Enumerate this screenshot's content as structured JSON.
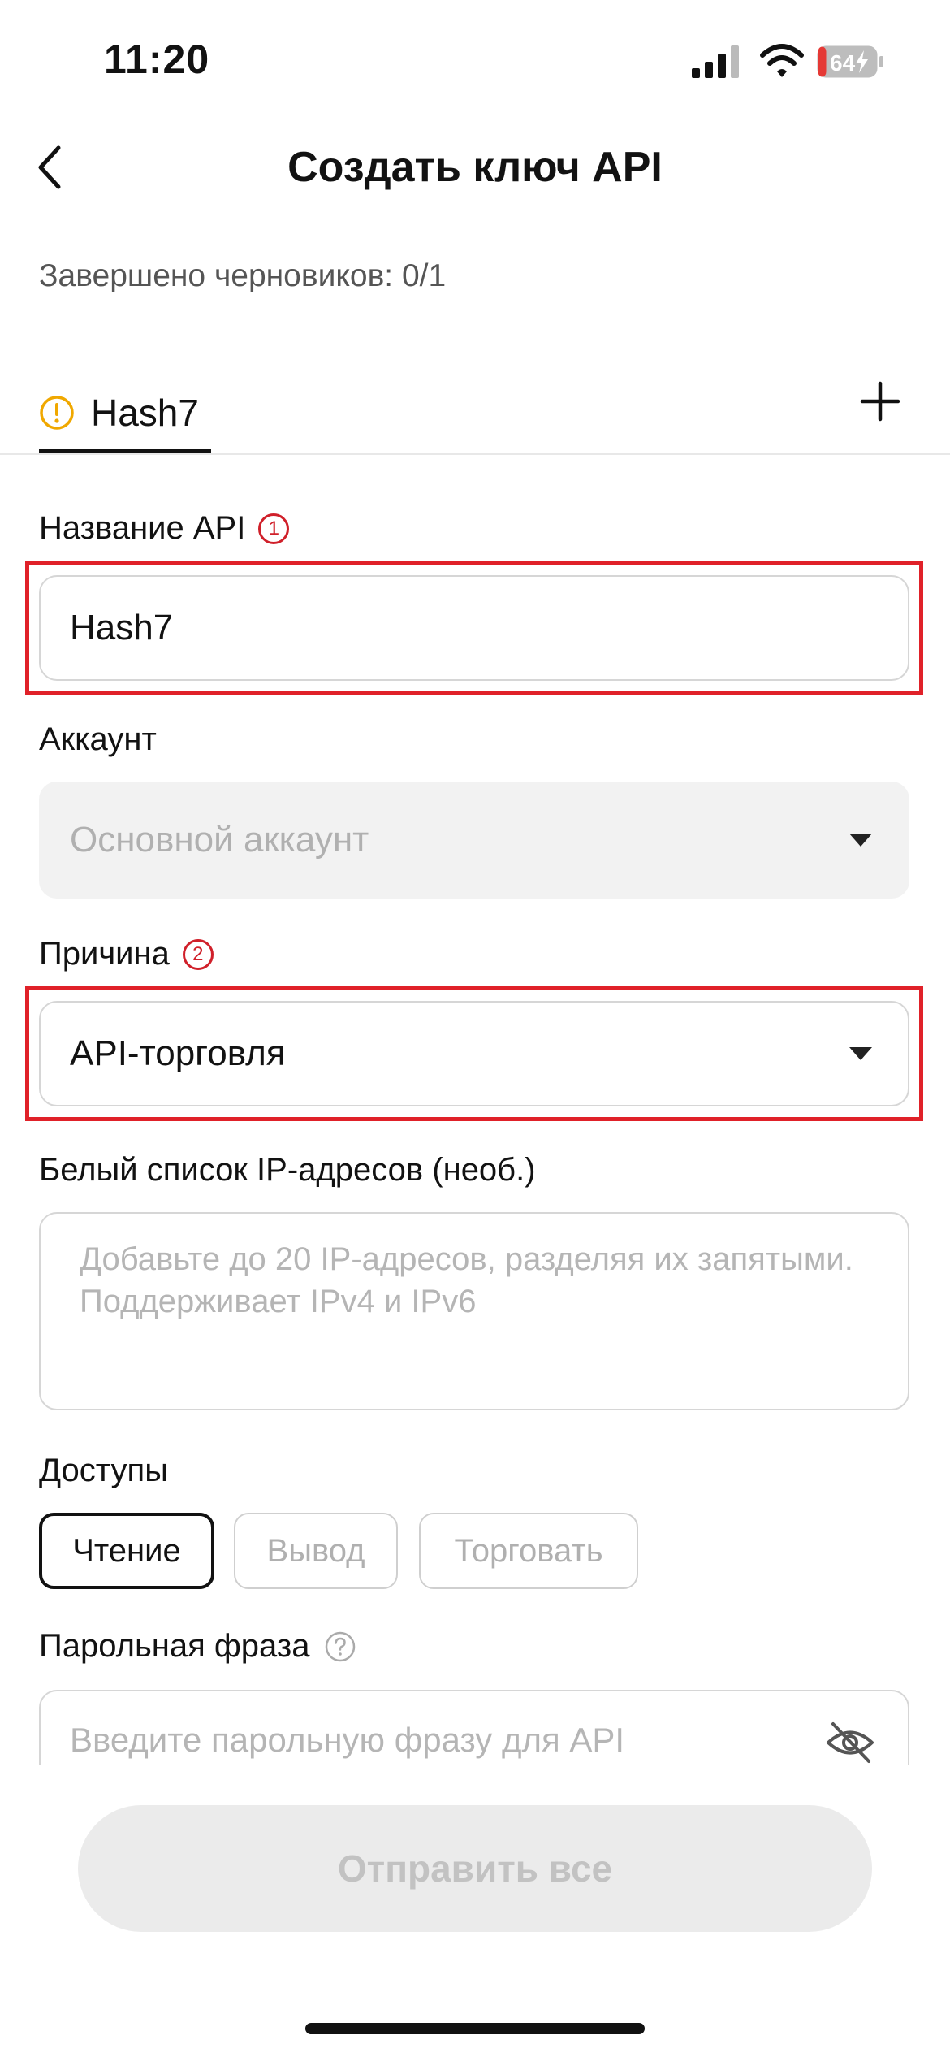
{
  "status_bar": {
    "time": "11:20",
    "battery": "64"
  },
  "header": {
    "title": "Создать ключ API"
  },
  "drafts_text": "Завершено черновиков: 0/1",
  "tabs": [
    {
      "label": "Hash7"
    }
  ],
  "form": {
    "api_name": {
      "label": "Название API",
      "step": "1",
      "value": "Hash7"
    },
    "account": {
      "label": "Аккаунт",
      "value": "Основной аккаунт"
    },
    "reason": {
      "label": "Причина",
      "step": "2",
      "value": "API-торговля"
    },
    "ip_whitelist": {
      "label": "Белый список IP-адресов (необ.)",
      "placeholder": "Добавьте до 20 IP-адресов, разделяя их запятыми. Поддерживает IPv4 и IPv6"
    },
    "permissions": {
      "label": "Доступы",
      "options": [
        {
          "label": "Чтение",
          "selected": true
        },
        {
          "label": "Вывод",
          "selected": false
        },
        {
          "label": "Торговать",
          "selected": false
        }
      ]
    },
    "passphrase": {
      "label": "Парольная фраза",
      "placeholder": "Введите парольную фразу для API"
    }
  },
  "submit_label": "Отправить все",
  "colors": {
    "highlight": "#e02129",
    "warning": "#f0a800",
    "step_badge": "#d0202a"
  }
}
